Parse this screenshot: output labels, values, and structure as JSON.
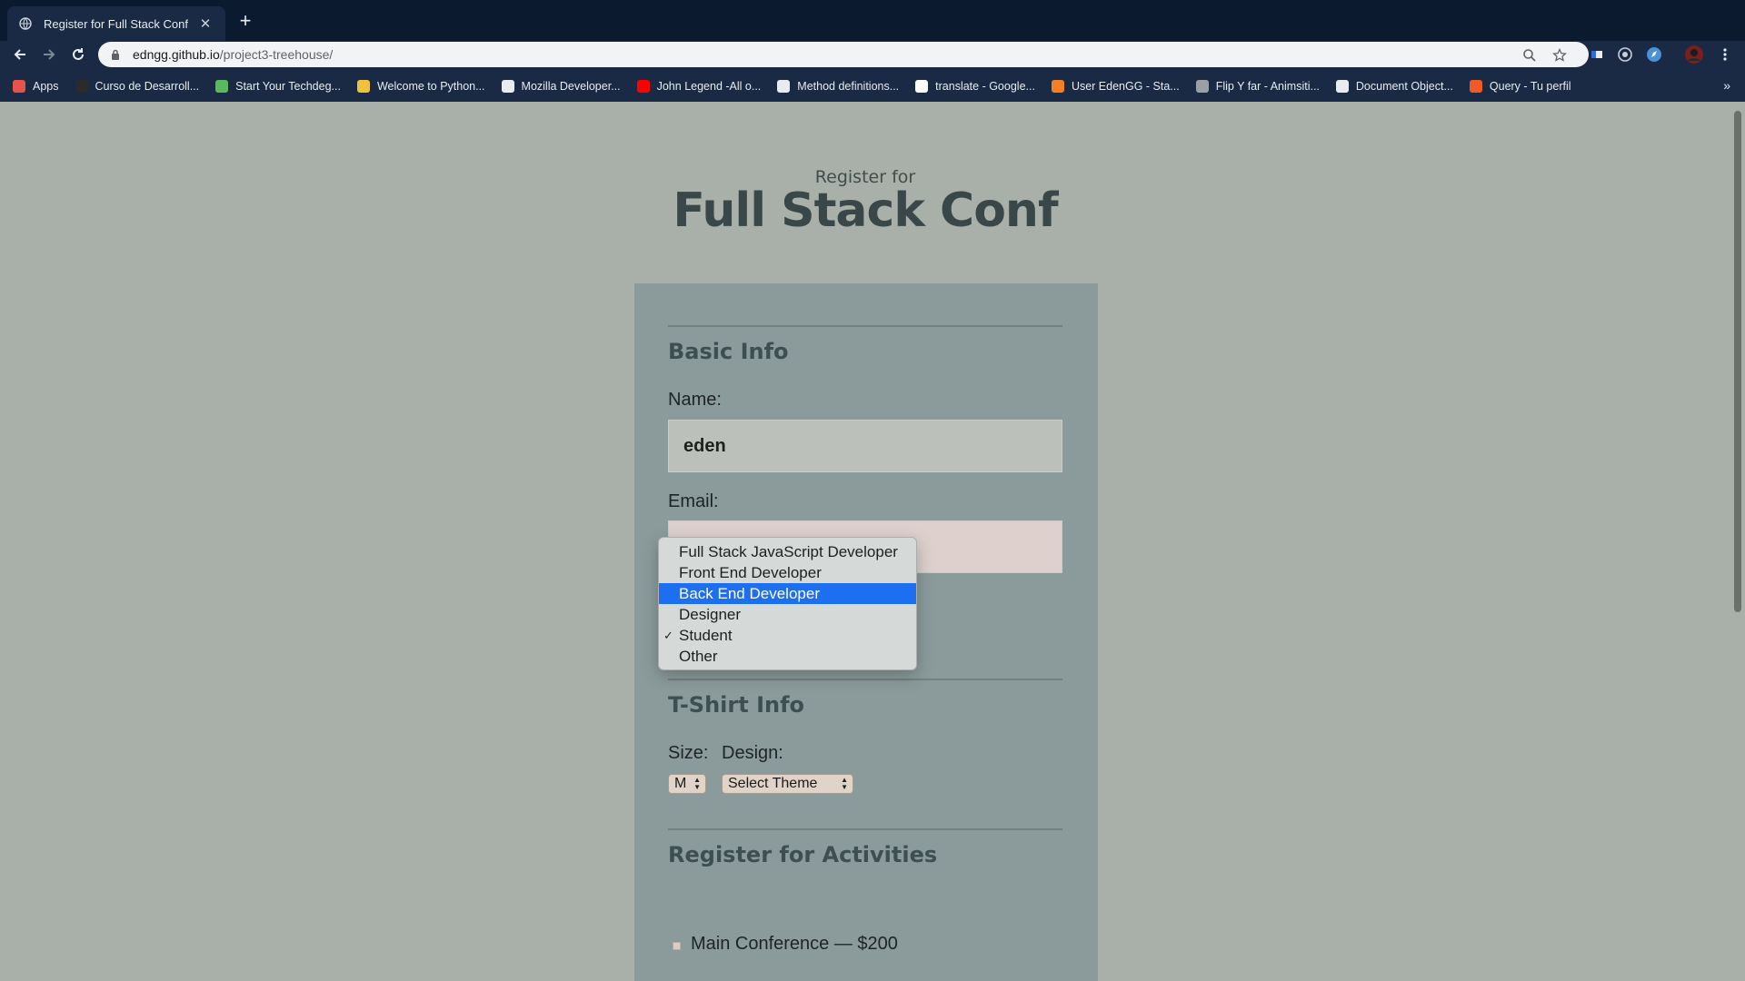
{
  "browser": {
    "tab_title": "Register for Full Stack Conf",
    "url_host": "edngg.github.io",
    "url_path": "/project3-treehouse/",
    "bookmarks": [
      {
        "label": "Apps",
        "color": "#e5534b"
      },
      {
        "label": "Curso de Desarroll...",
        "color": "#2b2b2b"
      },
      {
        "label": "Start Your Techdeg...",
        "color": "#5cb85c"
      },
      {
        "label": "Welcome to Python...",
        "color": "#f0c23b"
      },
      {
        "label": "Mozilla Developer...",
        "color": "#e8ecf2"
      },
      {
        "label": "John Legend -All o...",
        "color": "#ff0000"
      },
      {
        "label": "Method definitions...",
        "color": "#e8ecf2"
      },
      {
        "label": "translate - Google...",
        "color": "#ffffff"
      },
      {
        "label": "User EdenGG - Sta...",
        "color": "#f48024"
      },
      {
        "label": "Flip Y far - Animsiti...",
        "color": "#9aa0a6"
      },
      {
        "label": "Document Object...",
        "color": "#e8ecf2"
      },
      {
        "label": "Query - Tu perfil",
        "color": "#f05a28"
      }
    ],
    "more_bookmarks": "»"
  },
  "header": {
    "subtitle": "Register for",
    "title": "Full Stack Conf"
  },
  "basic_info": {
    "section_title": "Basic Info",
    "name_label": "Name:",
    "name_value": "eden",
    "email_label": "Email:",
    "email_value": ""
  },
  "job_role_dropdown": {
    "options": [
      {
        "label": "Full Stack JavaScript Developer",
        "highlighted": false,
        "checked": false
      },
      {
        "label": "Front End Developer",
        "highlighted": false,
        "checked": false
      },
      {
        "label": "Back End Developer",
        "highlighted": true,
        "checked": false
      },
      {
        "label": "Designer",
        "highlighted": false,
        "checked": false
      },
      {
        "label": "Student",
        "highlighted": false,
        "checked": true
      },
      {
        "label": "Other",
        "highlighted": false,
        "checked": false
      }
    ],
    "check_mark": "✓",
    "highlight_color": "#1d6ff2"
  },
  "tshirt": {
    "section_title": "T-Shirt Info",
    "size_label": "Size:",
    "size_value": "M",
    "design_label": "Design:",
    "design_value": "Select Theme"
  },
  "activities": {
    "section_title": "Register for Activities",
    "items": [
      {
        "label": "Main Conference — $200",
        "checked": false
      }
    ]
  }
}
